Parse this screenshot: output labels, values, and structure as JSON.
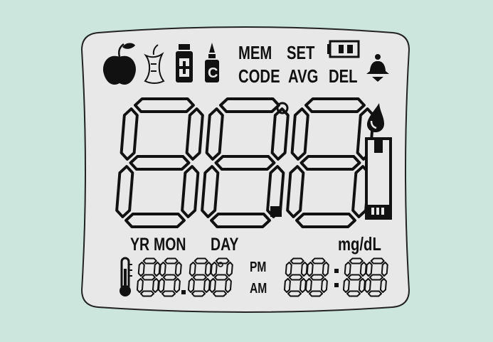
{
  "display": {
    "background_color": "#cce6de",
    "panel_color": "#e8e8e8",
    "segment_color": "#111111",
    "top_labels": {
      "mem": "MEM",
      "set": "SET",
      "code": "CODE",
      "avg": "AVG",
      "del": "DEL"
    },
    "main_reading": {
      "digits": [
        "8",
        "8",
        "8"
      ],
      "degree_symbol": "°",
      "decimal_point": "."
    },
    "unit_label": "mg/dL",
    "date_labels": {
      "year": "YR",
      "month": "MON",
      "day": "DAY"
    },
    "date_digits": [
      "8",
      "8",
      "8",
      "8"
    ],
    "time_labels": {
      "pm": "PM",
      "am": "AM"
    },
    "time_digits": [
      "8",
      "8",
      "8",
      "8"
    ],
    "time_colon": ":",
    "icons": [
      "apple-icon",
      "apple-core-icon",
      "medicine-bottle-icon",
      "control-solution-icon",
      "battery-icon",
      "bell-icon",
      "blood-drop-icon",
      "test-strip-icon",
      "thermometer-icon"
    ]
  }
}
